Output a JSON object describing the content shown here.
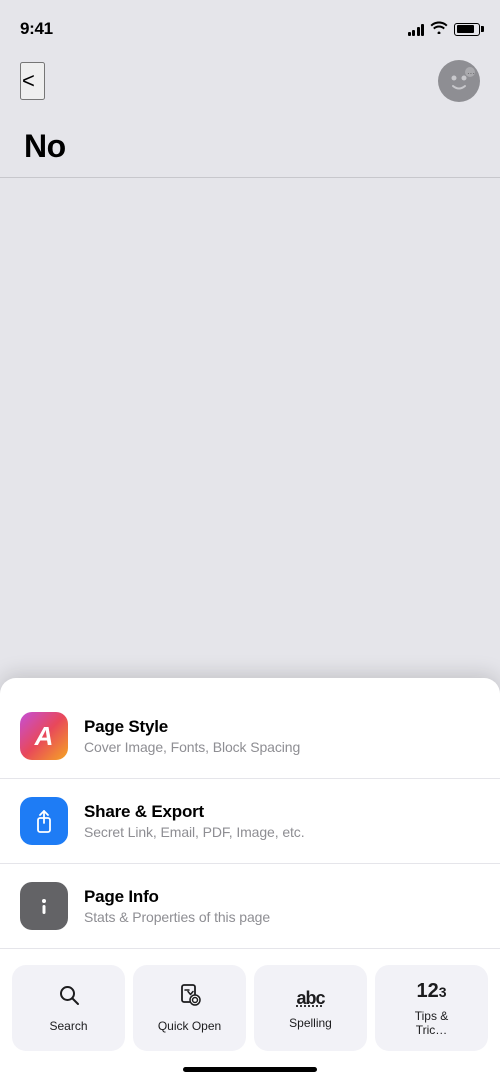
{
  "status_bar": {
    "time": "9:41",
    "signal_bars": [
      4,
      6,
      9,
      12,
      14
    ],
    "battery_level": 85
  },
  "nav": {
    "back_label": "<",
    "avatar_label": "···"
  },
  "page": {
    "title": "No"
  },
  "bottom_sheet": {
    "menu_items": [
      {
        "id": "page-style",
        "title": "Page Style",
        "subtitle": "Cover Image, Fonts, Block Spacing",
        "icon_type": "page-style"
      },
      {
        "id": "share-export",
        "title": "Share & Export",
        "subtitle": "Secret Link, Email, PDF, Image, etc.",
        "icon_type": "share"
      },
      {
        "id": "page-info",
        "title": "Page Info",
        "subtitle": "Stats & Properties of this page",
        "icon_type": "info"
      }
    ],
    "quick_actions": [
      {
        "id": "search",
        "label": "Search",
        "icon": "search"
      },
      {
        "id": "quick-open",
        "label": "Quick Open",
        "icon": "quick-open"
      },
      {
        "id": "spelling",
        "label": "Spelling",
        "icon": "spelling"
      },
      {
        "id": "tips-tricks",
        "label": "Tips & Tricks",
        "icon": "tips"
      }
    ]
  }
}
